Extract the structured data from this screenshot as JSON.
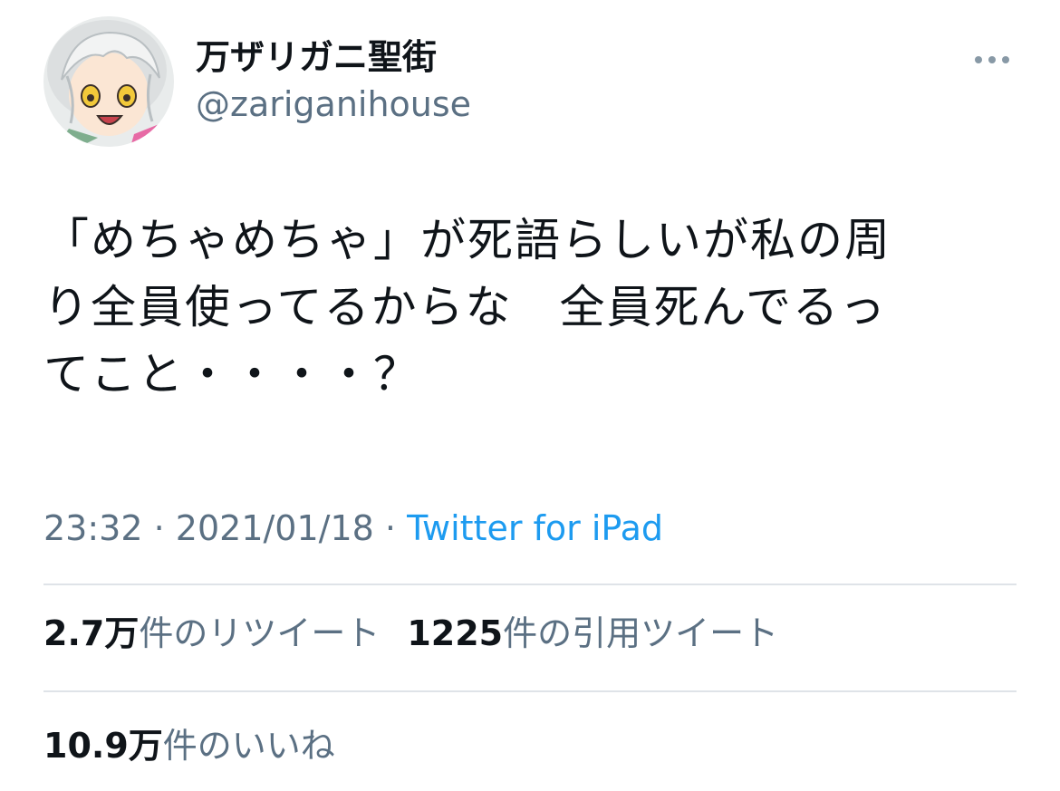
{
  "user": {
    "display_name": "万ザリガニ聖街",
    "handle": "@zariganihouse",
    "avatar_icon": "character-avatar-icon"
  },
  "menu": {
    "icon": "more-options-icon"
  },
  "tweet": {
    "text": "「めちゃめちゃ」が死語らしいが私の周\nり全員使ってるからな　全員死んでるっ\nてこと・・・・？",
    "time": "23:32",
    "separator": "·",
    "date": "2021/01/18",
    "source": "Twitter for iPad"
  },
  "stats": {
    "retweets": {
      "count": "2.7万",
      "label": "件のリツイート"
    },
    "quotes": {
      "count": "1225",
      "label": "件の引用ツイート"
    },
    "likes": {
      "count": "10.9万",
      "label": "件のいいね"
    }
  },
  "colors": {
    "text": "#0f1419",
    "secondary": "#5b7083",
    "link": "#1d9bf0",
    "divider": "#dfe3e8"
  }
}
